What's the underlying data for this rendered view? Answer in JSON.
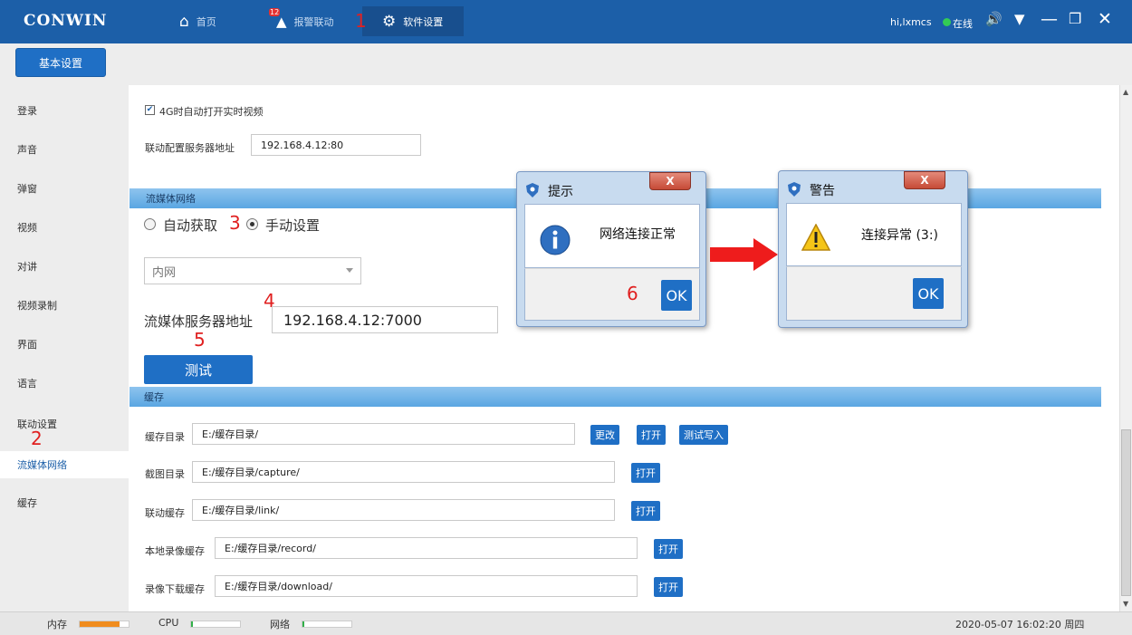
{
  "app": {
    "logo": "CONWIN"
  },
  "nav": {
    "home_label": "首页",
    "alarm_label": "报警联动",
    "alarm_badge": "12",
    "settings_label": "软件设置"
  },
  "user": {
    "name": "hi,lxmcs",
    "status": "在线"
  },
  "toolbar": {
    "basic_settings": "基本设置"
  },
  "sidebar": {
    "items": [
      {
        "label": "登录"
      },
      {
        "label": "声音"
      },
      {
        "label": "弹窗"
      },
      {
        "label": "视频"
      },
      {
        "label": "对讲"
      },
      {
        "label": "视频录制"
      },
      {
        "label": "界面"
      },
      {
        "label": "语言"
      },
      {
        "label": "联动设置"
      },
      {
        "label": "流媒体网络"
      },
      {
        "label": "缓存"
      }
    ]
  },
  "main": {
    "auto_video_checkbox": "4G时自动打开实时视频",
    "link_server_label": "联动配置服务器地址",
    "link_server_value": "192.168.4.12:80",
    "stream_section": "流媒体网络",
    "radio_auto": "自动获取",
    "radio_manual": "手动设置",
    "network_select": "内网",
    "stream_server_label": "流媒体服务器地址",
    "stream_server_value": "192.168.4.12:7000",
    "test_button": "测试",
    "cache_section": "缓存",
    "cache_rows": [
      {
        "label": "缓存目录",
        "value": "E:/缓存目录/",
        "buttons": [
          "更改",
          "打开",
          "测试写入"
        ]
      },
      {
        "label": "截图目录",
        "value": "E:/缓存目录/capture/",
        "buttons": [
          "打开"
        ]
      },
      {
        "label": "联动缓存",
        "value": "E:/缓存目录/link/",
        "buttons": [
          "打开"
        ]
      },
      {
        "label": "本地录像缓存",
        "value": "E:/缓存目录/record/",
        "buttons": [
          "打开"
        ]
      },
      {
        "label": "录像下载缓存",
        "value": "E:/缓存目录/download/",
        "buttons": [
          "打开"
        ]
      }
    ]
  },
  "dialog_info": {
    "title": "提示",
    "message": "网络连接正常",
    "ok": "OK"
  },
  "dialog_warn": {
    "title": "警告",
    "message": "连接异常 (3:)",
    "ok": "OK"
  },
  "annotations": [
    "1",
    "2",
    "3",
    "4",
    "5",
    "6"
  ],
  "statusbar": {
    "memory_label": "内存",
    "cpu_label": "CPU",
    "network_label": "网络",
    "memory_level": 0.82,
    "cpu_level": 0.04,
    "network_level": 0.04,
    "datetime": "2020-05-07 16:02:20 周四"
  },
  "colors": {
    "topbar": "#1c5fa8",
    "accent": "#1f6fc5",
    "memory_meter": "#f08c1e",
    "cpu_meter": "#33b04a",
    "annotation_red": "#e02020",
    "online": "#33cc55"
  }
}
